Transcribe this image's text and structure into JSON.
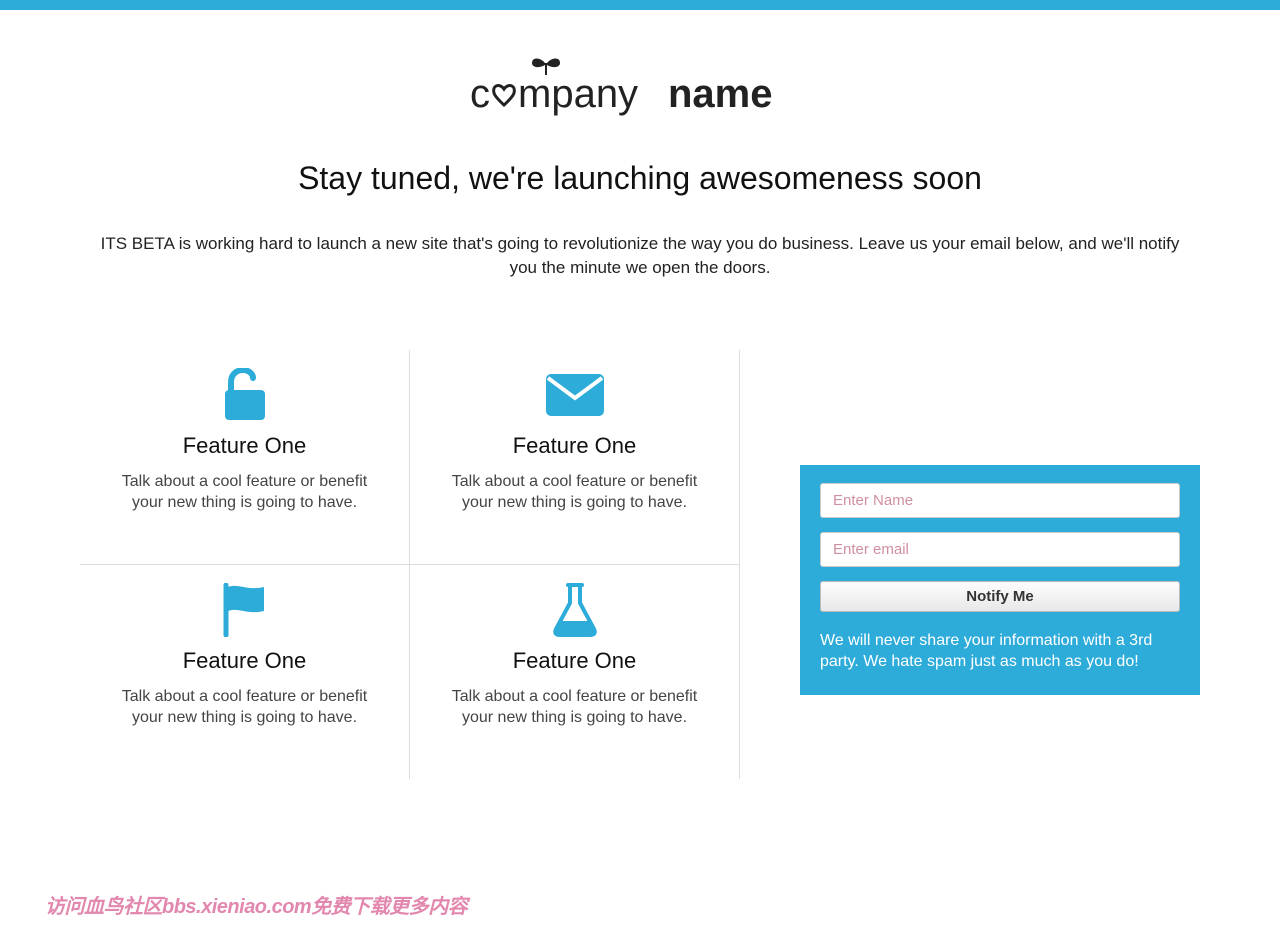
{
  "colors": {
    "accent": "#2dabd9",
    "watermark": "#df7aa5"
  },
  "logo": {
    "part1": "c",
    "part2": "mpany",
    "part3": "name"
  },
  "headline": "Stay tuned, we're launching awesomeness soon",
  "subheadline": "ITS BETA is working hard to launch a new site that's going to revolutionize the way you do business. Leave us your email below, and we'll notify you the minute we open the doors.",
  "features": [
    {
      "icon": "unlock-icon",
      "title": "Feature One",
      "desc": "Talk about a cool feature or benefit your new thing is going to have."
    },
    {
      "icon": "envelope-icon",
      "title": "Feature One",
      "desc": "Talk about a cool feature or benefit your new thing is going to have."
    },
    {
      "icon": "flag-icon",
      "title": "Feature One",
      "desc": "Talk about a cool feature or benefit your new thing is going to have."
    },
    {
      "icon": "flask-icon",
      "title": "Feature One",
      "desc": "Talk about a cool feature or benefit your new thing is going to have."
    }
  ],
  "signup": {
    "name_placeholder": "Enter Name",
    "email_placeholder": "Enter email",
    "button_label": "Notify Me",
    "privacy_text": "We will never share your information with a 3rd party. We hate spam just as much as you do!"
  },
  "watermark": "访问血鸟社区bbs.xieniao.com免费下载更多内容"
}
